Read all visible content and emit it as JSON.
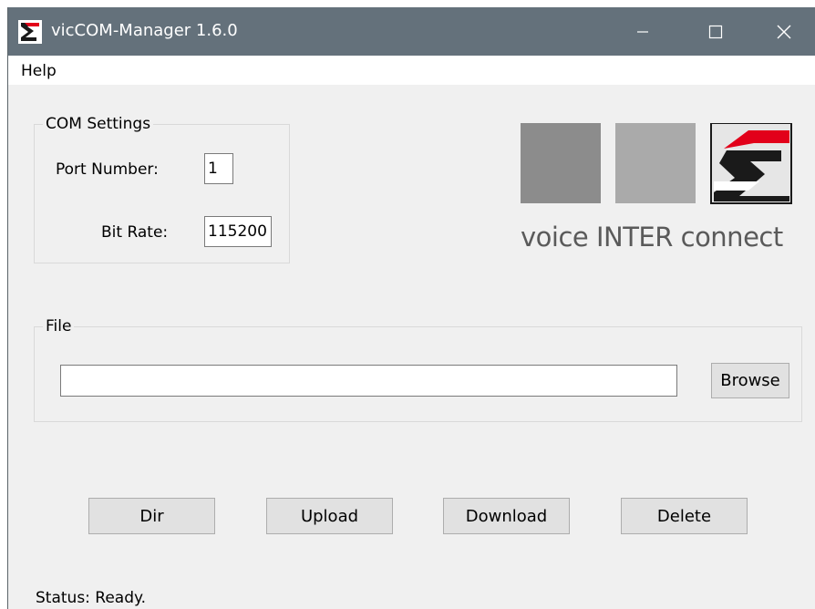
{
  "window": {
    "title": "vicCOM-Manager 1.6.0",
    "app_icon": "vic-logo-icon",
    "controls": [
      "minimize-icon",
      "maximize-icon",
      "close-icon"
    ],
    "titlebar_color": "#64717b"
  },
  "menu": {
    "items": [
      {
        "label": "Help"
      }
    ]
  },
  "com_settings": {
    "caption": "COM Settings",
    "port_label": "Port Number:",
    "port_value": "1",
    "bitrate_label": "Bit Rate:",
    "bitrate_value": "115200"
  },
  "logo": {
    "text": "voice INTER connect",
    "accent_color": "#e2001a"
  },
  "file": {
    "caption": "File",
    "path_value": "",
    "browse_label": "Browse"
  },
  "actions": {
    "dir_label": "Dir",
    "upload_label": "Upload",
    "download_label": "Download",
    "delete_label": "Delete"
  },
  "status": {
    "text": "Status: Ready."
  }
}
